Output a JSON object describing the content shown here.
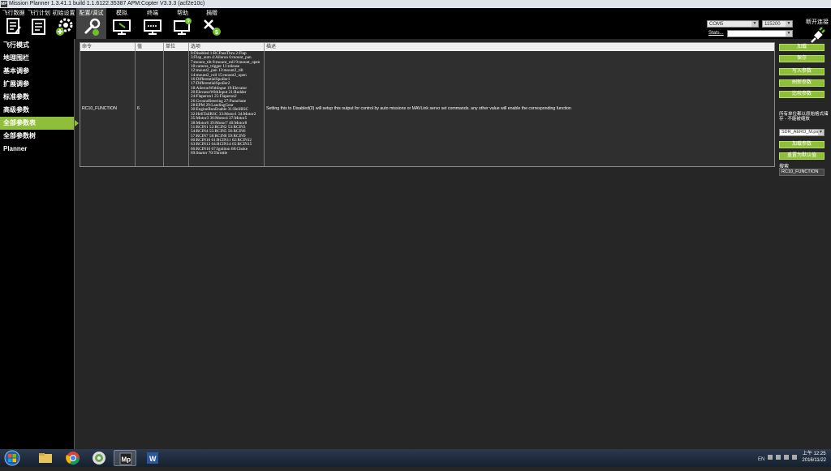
{
  "window": {
    "title": "Mission Planner 1.3.41.1 build 1.1.6122.35387 APM:Copter V3.3.3 (acf2e10c)",
    "app_icon": "MP"
  },
  "toolbar": {
    "items": [
      {
        "label": "飞行数据",
        "icon": "flight-data-icon"
      },
      {
        "label": "飞行计划",
        "icon": "flight-plan-icon"
      },
      {
        "label": "初始设置",
        "icon": "initial-setup-icon"
      },
      {
        "label": "配置/调试",
        "icon": "config-tuning-icon"
      },
      {
        "label": "模拟",
        "icon": "simulation-icon"
      },
      {
        "label": "终端",
        "icon": "terminal-icon"
      },
      {
        "label": "帮助",
        "icon": "help-icon"
      },
      {
        "label": "捐赠",
        "icon": "donate-icon"
      }
    ],
    "active_index": 3,
    "com_port": "COM5",
    "baud_rate": "115200",
    "stats_label": "Stats...",
    "connect_label": "断开连接"
  },
  "sidebar": {
    "items": [
      {
        "label": "飞行模式"
      },
      {
        "label": "地理围栏"
      },
      {
        "label": "基本调参"
      },
      {
        "label": "扩展调参"
      },
      {
        "label": "标准参数"
      },
      {
        "label": "高级参数"
      },
      {
        "label": "全部参数表"
      },
      {
        "label": "全部参数树"
      },
      {
        "label": "Planner"
      }
    ],
    "active_index": 6
  },
  "param_table": {
    "headers": [
      "命令",
      "值",
      "单位",
      "选项",
      "描述"
    ],
    "row": {
      "command": "RC10_FUNCTION",
      "value": "6",
      "units": "",
      "options": [
        "0:Disabled 1:RCPassThru 2:Flap",
        "3:Flap_auto 4:Aileron 6:mount_pan",
        "7:mount_tilt 8:mount_roll 9:mount_open",
        "10:camera_trigger 11:release",
        "12:mount2_pan 13:mount2_tilt",
        "14:mount2_roll 15:mount2_open",
        "16:DifferentialSpoiler1",
        "17:DifferentialSpoiler2",
        "18:AileronWithInput 19:Elevator",
        "20:ElevatorWithInput 21:Rudder",
        "24:Flaperon1 25:Flaperon2",
        "26:GroundSteering 27:Parachute",
        "28:EPM 29:LandingGear",
        "30:EngineRunEnable 31:HeliRSC",
        "32:HeliTailRSC 33:Motor1 34:Motor2",
        "35:Motor3 36:Motor4 37:Motor5",
        "38:Motor6 39:Motor7 40:Motor8",
        "51:RCIN1 52:RCIN2 53:RCIN3",
        "54:RCIN4 55:RCIN5 56:RCIN6",
        "57:RCIN7 58:RCIN8 59:RCIN9",
        "60:RCIN10 61:RCIN11 62:RCIN12",
        "63:RCIN13 64:RCIN14 65:RCIN15",
        "66:RCIN16 67:Ignition 68:Choke",
        "69:Starter 70:Throttle"
      ],
      "description": "Setting this to Disabled(0) will setup this output for control by auto missions or MAVLink servo set commands. any other value will enable the corresponding function"
    }
  },
  "right_panel": {
    "buttons": [
      "加载",
      "保存",
      "写入参数",
      "刷新参数",
      "比较参数"
    ],
    "note": "所有单位都以原始格式储存 - 不能被缩放",
    "param_file_selected": "SDR_AERO_M.pa...",
    "load_preset_label": "加载参数",
    "reset_default_label": "重置为默认值",
    "search_label": "搜索",
    "search_value": "RC10_FUNCTION"
  },
  "taskbar": {
    "apps": [
      "start-orb-icon",
      "explorer-icon",
      "chrome-icon",
      "media-center-icon",
      "mission-planner-icon",
      "word-icon"
    ],
    "tray_text": "EN",
    "time": "上午 12:25",
    "date": "2016/11/22"
  }
}
